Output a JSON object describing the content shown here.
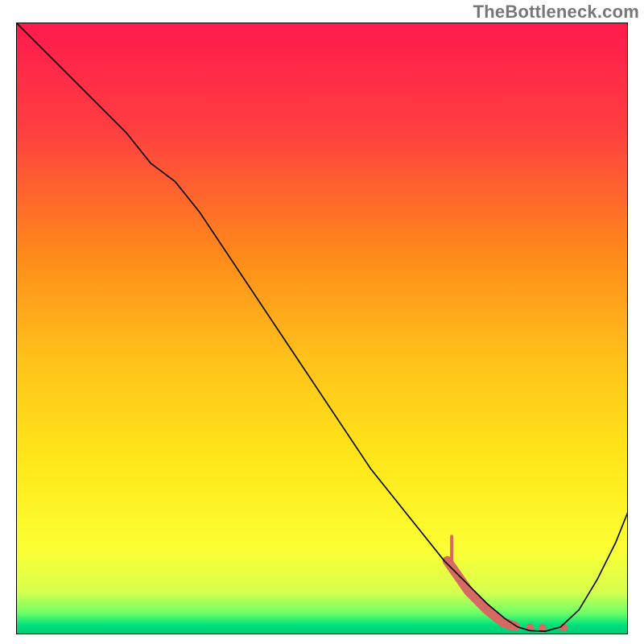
{
  "watermark": "TheBottleneck.com",
  "chart_data": {
    "type": "line",
    "title": "",
    "xlabel": "",
    "ylabel": "",
    "xlim": [
      0,
      100
    ],
    "ylim": [
      0,
      100
    ],
    "grid": false,
    "legend": false,
    "annotations": [],
    "background": {
      "type": "vertical-gradient",
      "description": "Smooth vertical gradient from red at the top, through orange and yellow, to a thin bright green band at the bottom",
      "stops": [
        {
          "pos": 0.0,
          "color": "#ff1a4d"
        },
        {
          "pos": 0.18,
          "color": "#ff4040"
        },
        {
          "pos": 0.38,
          "color": "#ff8a1a"
        },
        {
          "pos": 0.55,
          "color": "#ffc21a"
        },
        {
          "pos": 0.72,
          "color": "#ffe81a"
        },
        {
          "pos": 0.86,
          "color": "#fbff33"
        },
        {
          "pos": 0.93,
          "color": "#d8ff4d"
        },
        {
          "pos": 0.965,
          "color": "#6eff66"
        },
        {
          "pos": 0.985,
          "color": "#00e07a"
        },
        {
          "pos": 1.0,
          "color": "#00c97a"
        }
      ]
    },
    "series": [
      {
        "name": "curve",
        "stroke": "#000000",
        "stroke_width": 1.6,
        "x": [
          0,
          6,
          12,
          18,
          22,
          26,
          30,
          34,
          38,
          42,
          46,
          50,
          54,
          58,
          62,
          66,
          70,
          74,
          77,
          80,
          82,
          84,
          86.5,
          89,
          92,
          95,
          98,
          100
        ],
        "y": [
          100,
          94,
          88,
          82,
          77,
          74,
          69,
          63,
          57,
          51,
          45,
          39,
          33,
          27,
          22,
          17,
          12,
          8,
          5,
          2.5,
          1.2,
          0.6,
          0.5,
          1.2,
          4,
          9,
          15,
          20
        ]
      }
    ],
    "highlight": {
      "name": "valley-marker",
      "stroke": "#d66a63",
      "stroke_width": 12,
      "linecap": "round",
      "segments": [
        {
          "x": [
            70.5,
            74,
            77,
            79.5
          ],
          "y": [
            12,
            7,
            4,
            2
          ]
        },
        {
          "x": [
            79.5,
            81.5
          ],
          "y": [
            2,
            1.3
          ]
        }
      ],
      "dots": [
        {
          "x": 84.0,
          "y": 1.1,
          "r": 5
        },
        {
          "x": 86.0,
          "y": 1.0,
          "r": 5
        },
        {
          "x": 89.5,
          "y": 1.1,
          "r": 5
        }
      ],
      "tick": {
        "x": 71.2,
        "y_top": 16,
        "y_bot": 12
      }
    }
  }
}
